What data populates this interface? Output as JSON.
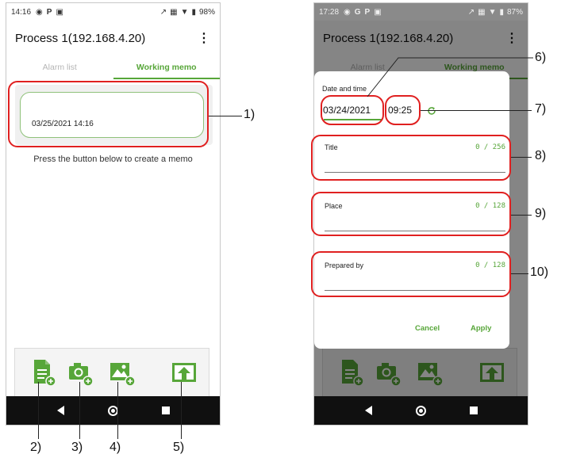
{
  "left": {
    "status_time": "14:16",
    "status_battery": "98%",
    "app_title": "Process 1(192.168.4.20)",
    "menu_glyph": "⋮",
    "tabs": [
      "Alarm list",
      "Working memo"
    ],
    "memo_datetime": "03/25/2021 14:16",
    "hint": "Press the button below to create a memo",
    "toolbar_icons": [
      "new-memo-icon",
      "camera-icon",
      "add-image-icon",
      "export-icon"
    ]
  },
  "right": {
    "status_time": "17:28",
    "status_battery": "87%",
    "app_title": "Process 1(192.168.4.20)",
    "menu_glyph": "⋮",
    "tabs": [
      "Alarm list",
      "Working memo"
    ],
    "dialog": {
      "date_time_label": "Date and time",
      "date": "03/24/2021",
      "time": "09:25",
      "fields": [
        {
          "label": "Title",
          "count": "0 / 256"
        },
        {
          "label": "Place",
          "count": "0 / 128"
        },
        {
          "label": "Prepared by",
          "count": "0 / 128"
        }
      ],
      "cancel": "Cancel",
      "apply": "Apply"
    }
  },
  "annotations": [
    "1)",
    "2)",
    "3)",
    "4)",
    "5)",
    "6)",
    "7)",
    "8)",
    "9)",
    "10)"
  ],
  "colors": {
    "accent": "#57a639",
    "callout": "#e02020",
    "navbar": "#101010"
  }
}
